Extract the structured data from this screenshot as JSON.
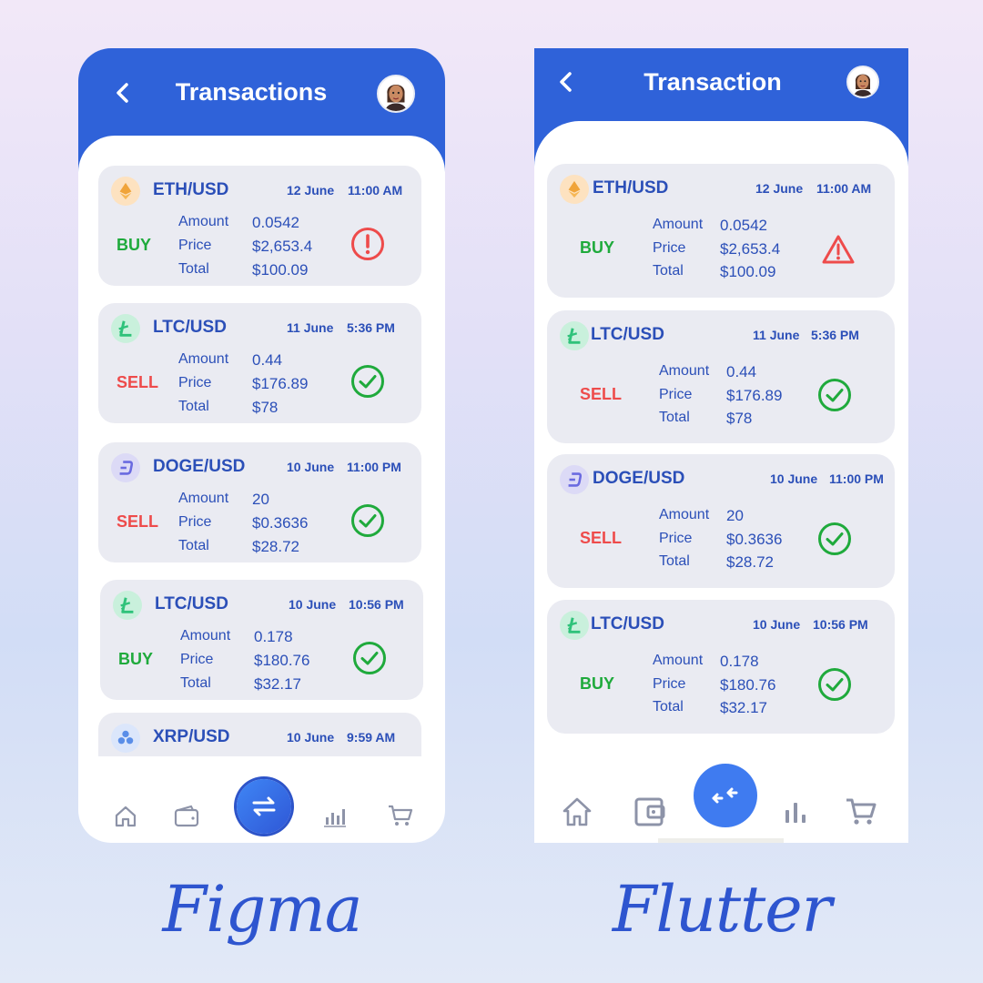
{
  "colors": {
    "header_blue": "#2f62d9",
    "text_blue": "#2b4fb8",
    "buy_green": "#1faa3c",
    "sell_red": "#ee4b4b",
    "card_gray": "#eaebf2"
  },
  "figma": {
    "caption": "Figma",
    "header": {
      "back_icon": "chevron-left-icon",
      "title": "Transactions",
      "avatar": "avatar"
    },
    "transactions": [
      {
        "icon": "ethereum-icon",
        "pair": "ETH/USD",
        "date": "12 June",
        "time": "11:00 AM",
        "side": "BUY",
        "amount_label": "Amount",
        "amount": "0.0542",
        "price_label": "Price",
        "price": "$2,653.4",
        "total_label": "Total",
        "total": "$100.09",
        "status": "error-circle-icon"
      },
      {
        "icon": "litecoin-icon",
        "pair": "LTC/USD",
        "date": "11 June",
        "time": "5:36 PM",
        "side": "SELL",
        "amount_label": "Amount",
        "amount": "0.44",
        "price_label": "Price",
        "price": "$176.89",
        "total_label": "Total",
        "total": "$78",
        "status": "check-circle-icon"
      },
      {
        "icon": "dash-icon",
        "pair": "DOGE/USD",
        "date": "10 June",
        "time": "11:00 PM",
        "side": "SELL",
        "amount_label": "Amount",
        "amount": "20",
        "price_label": "Price",
        "price": "$0.3636",
        "total_label": "Total",
        "total": "$28.72",
        "status": "check-circle-icon"
      },
      {
        "icon": "litecoin-icon",
        "pair": "LTC/USD",
        "date": "10 June",
        "time": "10:56 PM",
        "side": "BUY",
        "amount_label": "Amount",
        "amount": "0.178",
        "price_label": "Price",
        "price": "$180.76",
        "total_label": "Total",
        "total": "$32.17",
        "status": "check-circle-icon"
      },
      {
        "icon": "xrp-icon",
        "pair": "XRP/USD",
        "date": "10 June",
        "time": "9:59 AM"
      }
    ],
    "nav": [
      "home-icon",
      "wallet-icon",
      "swap-icon",
      "chart-icon",
      "cart-icon"
    ]
  },
  "flutter": {
    "caption": "Flutter",
    "header": {
      "back_icon": "chevron-left-icon",
      "title": "Transaction",
      "avatar": "avatar"
    },
    "transactions": [
      {
        "icon": "ethereum-icon",
        "pair": "ETH/USD",
        "date": "12 June",
        "time": "11:00 AM",
        "side": "BUY",
        "amount_label": "Amount",
        "amount": "0.0542",
        "price_label": "Price",
        "price": "$2,653.4",
        "total_label": "Total",
        "total": "$100.09",
        "status": "warning-triangle-icon"
      },
      {
        "icon": "litecoin-icon",
        "pair": "LTC/USD",
        "date": "11 June",
        "time": "5:36 PM",
        "side": "SELL",
        "amount_label": "Amount",
        "amount": "0.44",
        "price_label": "Price",
        "price": "$176.89",
        "total_label": "Total",
        "total": "$78",
        "status": "check-circle-icon"
      },
      {
        "icon": "dash-icon",
        "pair": "DOGE/USD",
        "date": "10 June",
        "time": "11:00 PM",
        "side": "SELL",
        "amount_label": "Amount",
        "amount": "20",
        "price_label": "Price",
        "price": "$0.3636",
        "total_label": "Total",
        "total": "$28.72",
        "status": "check-circle-icon"
      },
      {
        "icon": "litecoin-icon",
        "pair": "LTC/USD",
        "date": "10 June",
        "time": "10:56 PM",
        "side": "BUY",
        "amount_label": "Amount",
        "amount": "0.178",
        "price_label": "Price",
        "price": "$180.76",
        "total_label": "Total",
        "total": "$32.17",
        "status": "check-circle-icon"
      }
    ],
    "nav": [
      "home-icon",
      "wallet-icon",
      "swap-icon",
      "chart-icon",
      "cart-icon"
    ]
  }
}
